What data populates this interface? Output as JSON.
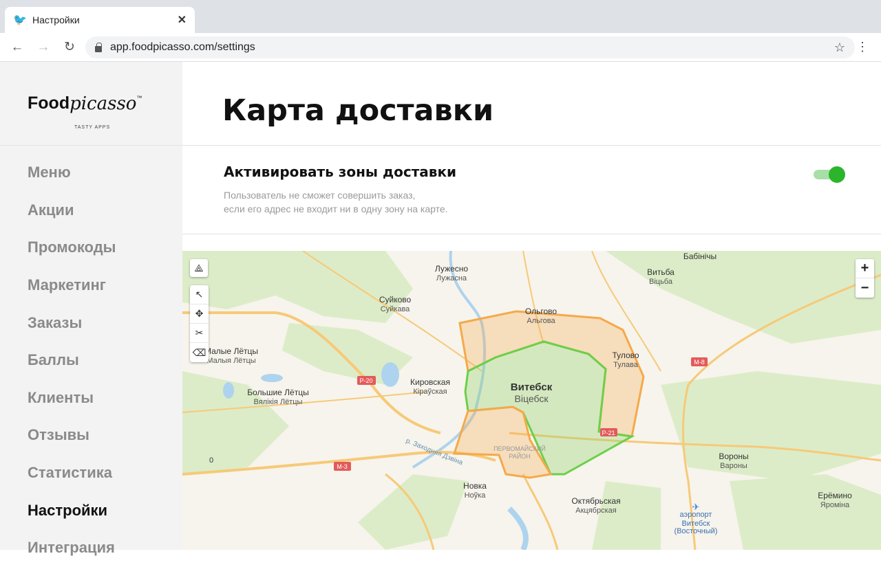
{
  "browser": {
    "tab_title": "Настройки",
    "url": "app.foodpicasso.com/settings",
    "favicon": "bird-icon"
  },
  "logo": {
    "food": "Food",
    "picasso": "picasso",
    "tm": "™",
    "tagline": "TASTY APPS"
  },
  "sidebar": {
    "items": [
      {
        "label": "Меню"
      },
      {
        "label": "Акции"
      },
      {
        "label": "Промокоды"
      },
      {
        "label": "Маркетинг"
      },
      {
        "label": "Заказы"
      },
      {
        "label": "Баллы"
      },
      {
        "label": "Клиенты"
      },
      {
        "label": "Отзывы"
      },
      {
        "label": "Статистика"
      },
      {
        "label": "Настройки",
        "active": true
      },
      {
        "label": "Интеграция"
      }
    ]
  },
  "page": {
    "title": "Карта доставки",
    "section": {
      "title": "Активировать зоны доставки",
      "desc1": "Пользователь не сможет совершить заказ,",
      "desc2": "если его адрес не входит ни в одну зону на карте.",
      "toggle_on": true
    }
  },
  "map": {
    "zoom_in": "+",
    "zoom_out": "−",
    "colors": {
      "orange_zone": "#f5a94a",
      "green_zone": "#6ccf4a",
      "bg": "#f6f4ec",
      "forest": "#dcecc8",
      "road": "#f7c978",
      "water": "#aed3ee"
    },
    "labels": [
      {
        "t": "Лужесно",
        "s": "Лужасна"
      },
      {
        "t": "Суйково",
        "s": "Суйкава"
      },
      {
        "t": "Ольгово",
        "s": "Альгова"
      },
      {
        "t": "Бабінічы",
        "s": ""
      },
      {
        "t": "Витьба",
        "s": "Віцьба"
      },
      {
        "t": "Малые Лётцы",
        "s": "Малыя Лётцы"
      },
      {
        "t": "Тулово",
        "s": "Тулава"
      },
      {
        "t": "Кировская",
        "s": "Кіраўская"
      },
      {
        "t": "Витебск",
        "s": "Віцебск"
      },
      {
        "t": "Большие Лётцы",
        "s": "Вялікія Лётцы"
      },
      {
        "t": "Вороны",
        "s": "Вароны"
      },
      {
        "t": "Новка",
        "s": "Ноўка"
      },
      {
        "t": "Октябрьская",
        "s": "Акцябрская"
      },
      {
        "t": "Ерёмино",
        "s": "Яроміна"
      },
      {
        "t": "аэропорт",
        "s": "Витебск"
      },
      {
        "t": "(Восточный)",
        "s": ""
      }
    ],
    "misc": {
      "district1": "ПЕРВОМАЙСКИЙ",
      "district2": "РАЙОН",
      "river": "р. Заходняя Дзвіна",
      "r20": "Р-20",
      "r21": "Р-21",
      "m3": "М-3",
      "m8": "М-8",
      "zero": "0"
    }
  }
}
